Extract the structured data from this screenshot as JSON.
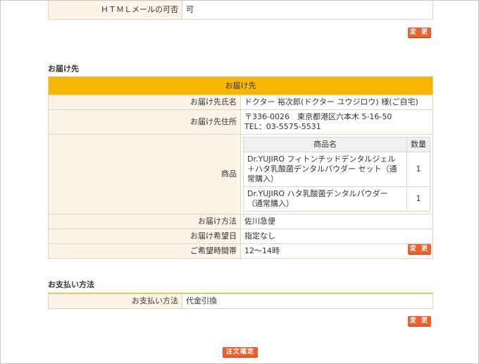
{
  "html_mail": {
    "label": "ＨＴＭＬメールの可否",
    "value": "可"
  },
  "edit_label": "変 更",
  "delivery": {
    "section_title": "お届け先",
    "header": "お届け先",
    "name_label": "お届け先氏名",
    "name_value": "ドクター 裕次郎(ドクター ユウジロウ) 様(ご自宅)",
    "address_label": "お届け先住所",
    "address_line1": "〒336-0026　東京都港区六本木 5-16-50",
    "address_line2": "TEL：03-5575-5531",
    "products_label": "商品",
    "product_col": "商品名",
    "qty_col": "数量",
    "products": [
      {
        "name": "Dr.YUJIRO フィトンチッドデンタルジェル＋ハタ乳酸菌デンタルパウダー セット（通常購入）",
        "qty": "1"
      },
      {
        "name": "Dr.YUJIRO ハタ乳酸菌デンタルパウダー（通常購入）",
        "qty": "1"
      }
    ],
    "method_label": "お届け方法",
    "method_value": "佐川急便",
    "date_label": "お届け希望日",
    "date_value": "指定なし",
    "time_label": "ご希望時間帯",
    "time_value": "12〜14時"
  },
  "payment": {
    "section_title": "お支払い方法",
    "label": "お支払い方法",
    "value": "代金引換"
  },
  "confirm_label": "注文確定"
}
